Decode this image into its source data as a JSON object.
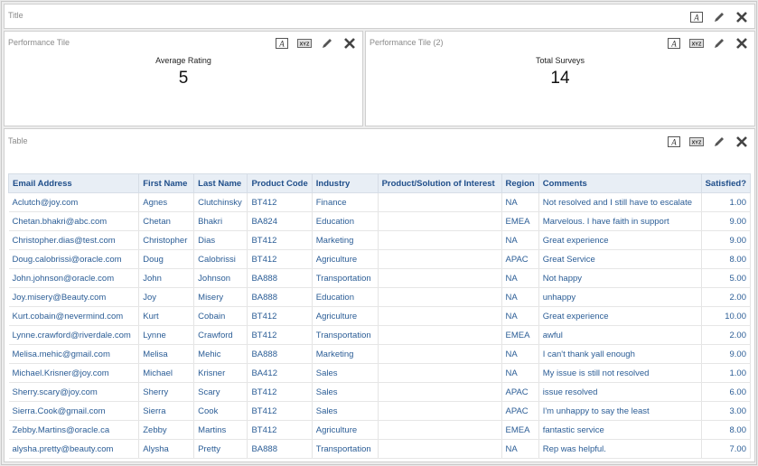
{
  "title_panel": {
    "label": "Title"
  },
  "tile1": {
    "label": "Performance Tile",
    "metric_label": "Average Rating",
    "metric_value": "5"
  },
  "tile2": {
    "label": "Performance Tile (2)",
    "metric_label": "Total Surveys",
    "metric_value": "14"
  },
  "table_panel": {
    "label": "Table"
  },
  "tool_icons": [
    "format-text-icon",
    "format-xyz-icon",
    "edit-pencil-icon",
    "close-x-icon"
  ],
  "tool_text": {
    "format": "A",
    "xyz": "XYZ"
  },
  "table": {
    "columns": [
      "Email Address",
      "First Name",
      "Last Name",
      "Product Code",
      "Industry",
      "Product/Solution of Interest",
      "Region",
      "Comments",
      "Satisfied?"
    ],
    "rows": [
      [
        "Aclutch@joy.com",
        "Agnes",
        "Clutchinsky",
        "BT412",
        "Finance",
        "",
        "NA",
        "Not resolved and I still have to escalate",
        "1.00"
      ],
      [
        "Chetan.bhakri@abc.com",
        "Chetan",
        "Bhakri",
        "BA824",
        "Education",
        "",
        "EMEA",
        "Marvelous. I have faith in support",
        "9.00"
      ],
      [
        "Christopher.dias@test.com",
        "Christopher",
        "Dias",
        "BT412",
        "Marketing",
        "",
        "NA",
        "Great experience",
        "9.00"
      ],
      [
        "Doug.calobrissi@oracle.com",
        "Doug",
        "Calobrissi",
        "BT412",
        "Agriculture",
        "",
        "APAC",
        "Great Service",
        "8.00"
      ],
      [
        "John.johnson@oracle.com",
        "John",
        "Johnson",
        "BA888",
        "Transportation",
        "",
        "NA",
        "Not happy",
        "5.00"
      ],
      [
        "Joy.misery@Beauty.com",
        "Joy",
        "Misery",
        "BA888",
        "Education",
        "",
        "NA",
        "unhappy",
        "2.00"
      ],
      [
        "Kurt.cobain@nevermind.com",
        "Kurt",
        "Cobain",
        "BT412",
        "Agriculture",
        "",
        "NA",
        "Great experience",
        "10.00"
      ],
      [
        "Lynne.crawford@riverdale.com",
        "Lynne",
        "Crawford",
        "BT412",
        "Transportation",
        "",
        "EMEA",
        "awful",
        "2.00"
      ],
      [
        "Melisa.mehic@gmail.com",
        "Melisa",
        "Mehic",
        "BA888",
        "Marketing",
        "",
        "NA",
        "I can't thank yall enough",
        "9.00"
      ],
      [
        "Michael.Krisner@joy.com",
        "Michael",
        "Krisner",
        "BA412",
        "Sales",
        "",
        "NA",
        "My issue is still not resolved",
        "1.00"
      ],
      [
        "Sherry.scary@joy.com",
        "Sherry",
        "Scary",
        "BT412",
        "Sales",
        "",
        "APAC",
        "issue resolved",
        "6.00"
      ],
      [
        "Sierra.Cook@gmail.com",
        "Sierra",
        "Cook",
        "BT412",
        "Sales",
        "",
        "APAC",
        "I'm unhappy to say the least",
        "3.00"
      ],
      [
        "Zebby.Martins@oracle.ca",
        "Zebby",
        "Martins",
        "BT412",
        "Agriculture",
        "",
        "EMEA",
        "fantastic service",
        "8.00"
      ],
      [
        "alysha.pretty@beauty.com",
        "Alysha",
        "Pretty",
        "BA888",
        "Transportation",
        "",
        "NA",
        "Rep was helpful.",
        "7.00"
      ]
    ]
  }
}
